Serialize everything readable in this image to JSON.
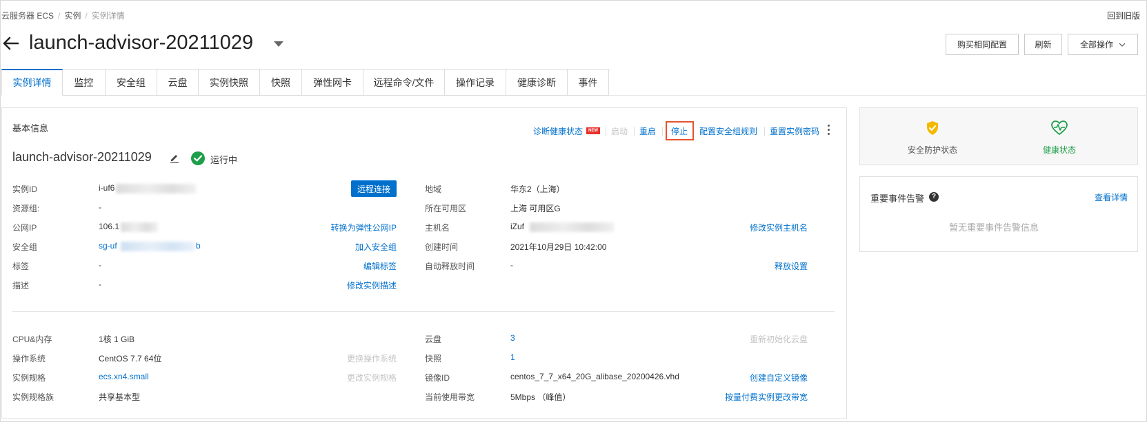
{
  "breadcrumb": {
    "items": [
      "云服务器 ECS",
      "实例",
      "实例详情"
    ],
    "back_to_old": "回到旧版"
  },
  "header": {
    "title": "launch-advisor-20211029",
    "buttons": {
      "buy_same": "购买相同配置",
      "refresh": "刷新",
      "all_actions": "全部操作"
    }
  },
  "tabs": [
    "实例详情",
    "监控",
    "安全组",
    "云盘",
    "实例快照",
    "快照",
    "弹性网卡",
    "远程命令/文件",
    "操作记录",
    "健康诊断",
    "事件"
  ],
  "basic": {
    "section_title": "基本信息",
    "actions": {
      "diagnose": "诊断健康状态",
      "new_badge": "NEW",
      "start": "启动",
      "restart": "重启",
      "stop": "停止",
      "config_sg_rules": "配置安全组规则",
      "reset_password": "重置实例密码"
    },
    "instance_name": "launch-advisor-20211029",
    "status": "运行中",
    "remote_connect": "远程连接",
    "left_rows": [
      {
        "label": "实例ID",
        "value": "i-uf6",
        "action": ""
      },
      {
        "label": "资源组:",
        "value": "-",
        "action": ""
      },
      {
        "label": "公网IP",
        "value": "106.1",
        "action": "转换为弹性公网IP"
      },
      {
        "label": "安全组",
        "value": "sg-uf",
        "value_tail": "b",
        "action": "加入安全组"
      },
      {
        "label": "标签",
        "value": "-",
        "action": "编辑标签"
      },
      {
        "label": "描述",
        "value": "-",
        "action": "修改实例描述"
      }
    ],
    "right_rows": [
      {
        "label": "地域",
        "value": "华东2（上海）",
        "action": ""
      },
      {
        "label": "所在可用区",
        "value": "上海 可用区G",
        "action": ""
      },
      {
        "label": "主机名",
        "value": "iZuf",
        "action": "修改实例主机名"
      },
      {
        "label": "创建时间",
        "value": "2021年10月29日 10:42:00",
        "action": ""
      },
      {
        "label": "自动释放时间",
        "value": "-",
        "action": "释放设置"
      }
    ],
    "left_rows2": [
      {
        "label": "CPU&内存",
        "value": "1核 1 GiB",
        "action": ""
      },
      {
        "label": "操作系统",
        "value": "CentOS 7.7 64位",
        "action": "更换操作系统"
      },
      {
        "label": "实例规格",
        "value": "ecs.xn4.small",
        "action": "更改实例规格"
      },
      {
        "label": "实例规格族",
        "value": "共享基本型",
        "action": ""
      }
    ],
    "right_rows2": [
      {
        "label": "云盘",
        "value": "3",
        "action": "重新初始化云盘"
      },
      {
        "label": "快照",
        "value": "1",
        "action": ""
      },
      {
        "label": "镜像ID",
        "value": "centos_7_7_x64_20G_alibase_20200426.vhd",
        "action": "创建自定义镜像"
      },
      {
        "label": "当前使用带宽",
        "value": "5Mbps （峰值）",
        "action": "按量付费实例更改带宽"
      }
    ]
  },
  "status_panel": {
    "security": "安全防护状态",
    "health": "健康状态"
  },
  "events_panel": {
    "title": "重要事件告警",
    "view_details": "查看详情",
    "empty": "暂无重要事件告警信息"
  },
  "colors": {
    "accent": "#0070cc",
    "running": "#1e9e4a",
    "security_icon": "#f5b800",
    "health_icon": "#1e9e4a",
    "stop_highlight": "#e4532f"
  }
}
